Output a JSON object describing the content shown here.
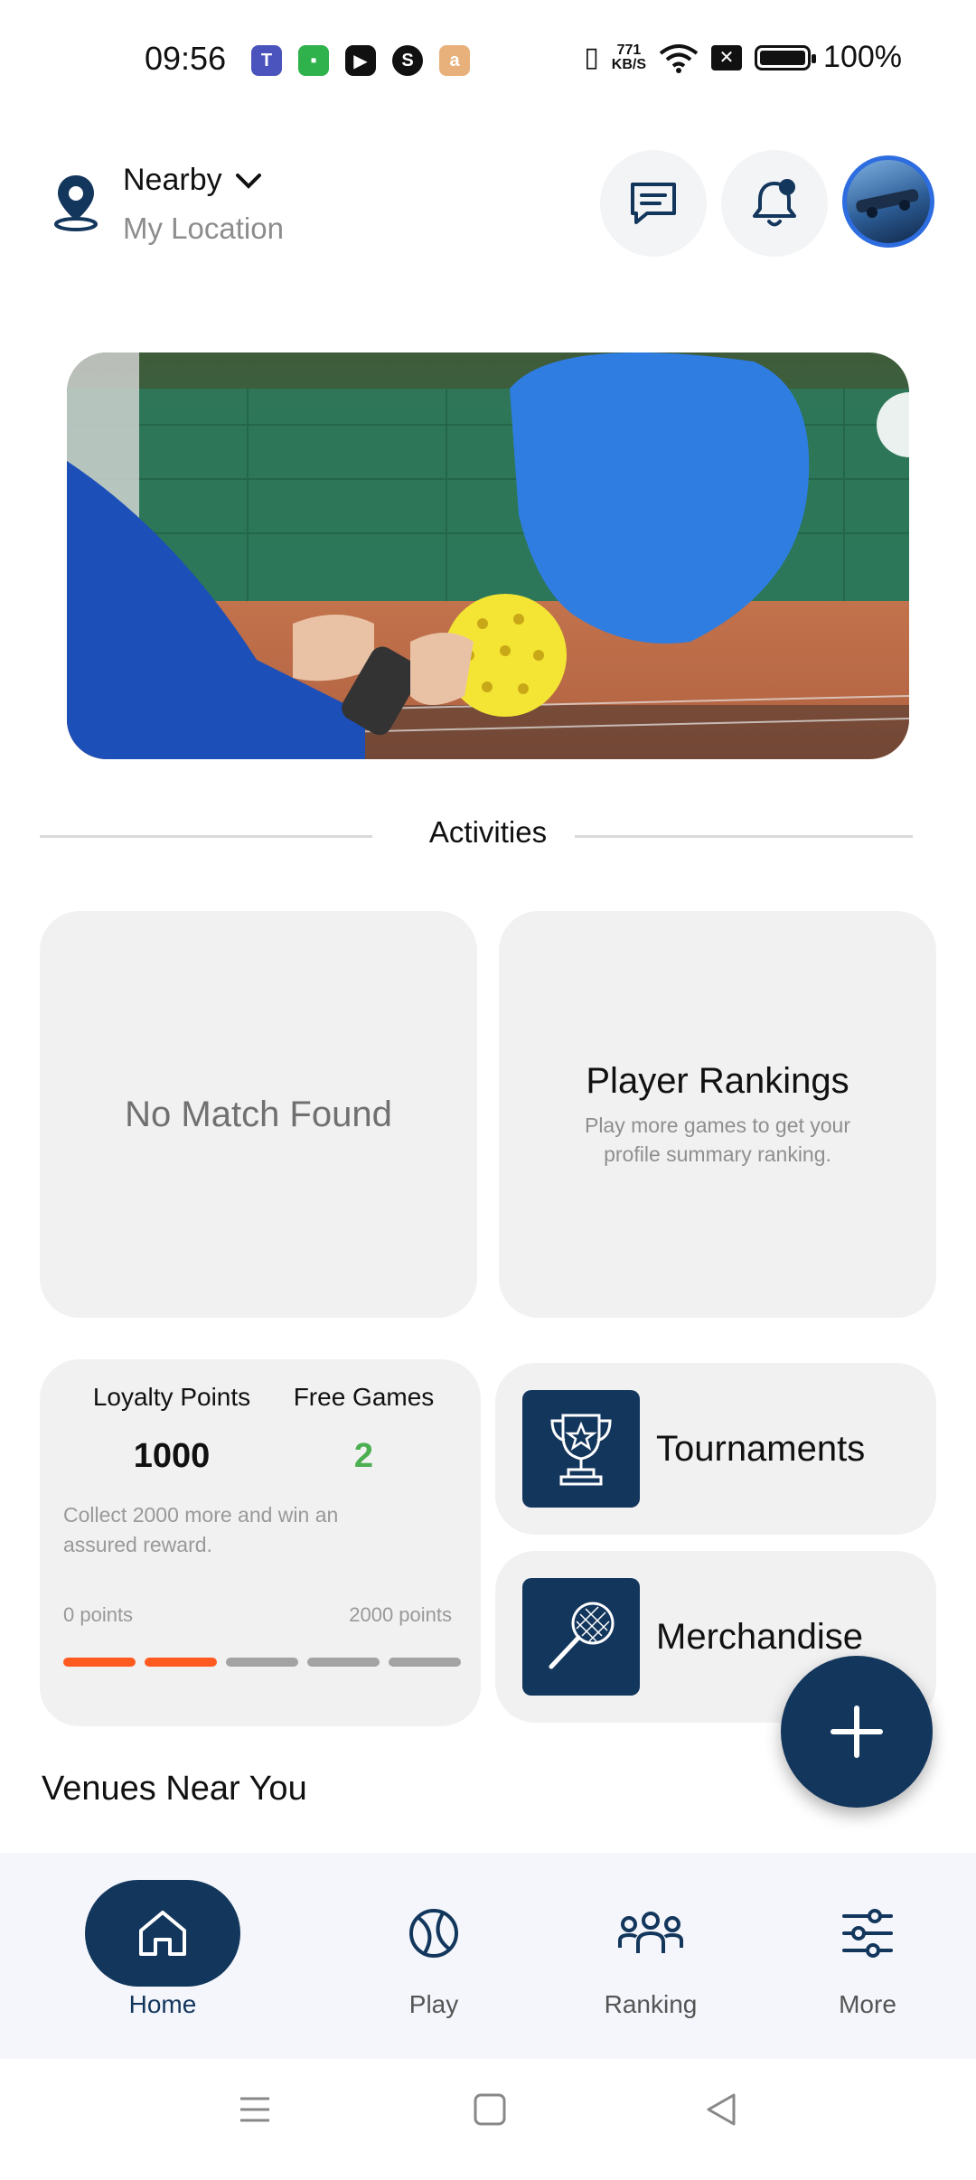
{
  "status_bar": {
    "time": "09:56",
    "net_speed_value": "771",
    "net_speed_unit": "KB/S",
    "battery": "100%",
    "icons": [
      "teams-icon",
      "app-icon",
      "youtube-icon",
      "skype-icon",
      "amazon-icon",
      "vibrate-icon",
      "wifi-icon",
      "battery-icon"
    ]
  },
  "header": {
    "location_title": "Nearby",
    "location_sub": "My Location"
  },
  "activities": {
    "heading": "Activities"
  },
  "cards": {
    "no_match": "No Match Found",
    "rankings_title": "Player Rankings",
    "rankings_sub": "Play more games to get your profile summary ranking."
  },
  "loyalty": {
    "points_label": "Loyalty Points",
    "points_value": "1000",
    "free_games_label": "Free Games",
    "free_games_value": "2",
    "note": "Collect 2000 more and win an assured reward.",
    "min_label": "0 points",
    "max_label": "2000 points",
    "segments_filled": 2,
    "segments_total": 5,
    "colors": {
      "filled": "#ff5a1f",
      "empty": "#a3a3a3",
      "free_games": "#4caf50"
    }
  },
  "side_cards": {
    "tournaments": "Tournaments",
    "merchandise": "Merchandise"
  },
  "venues_heading": "Venues Near You",
  "bottom_nav": {
    "items": [
      {
        "label": "Home",
        "icon": "home-icon",
        "active": true
      },
      {
        "label": "Play",
        "icon": "ball-icon",
        "active": false
      },
      {
        "label": "Ranking",
        "icon": "users-icon",
        "active": false
      },
      {
        "label": "More",
        "icon": "sliders-icon",
        "active": false
      }
    ]
  },
  "colors": {
    "brand": "#13365c",
    "accent": "#ff5a1f",
    "avatar_ring": "#2e6de0"
  }
}
